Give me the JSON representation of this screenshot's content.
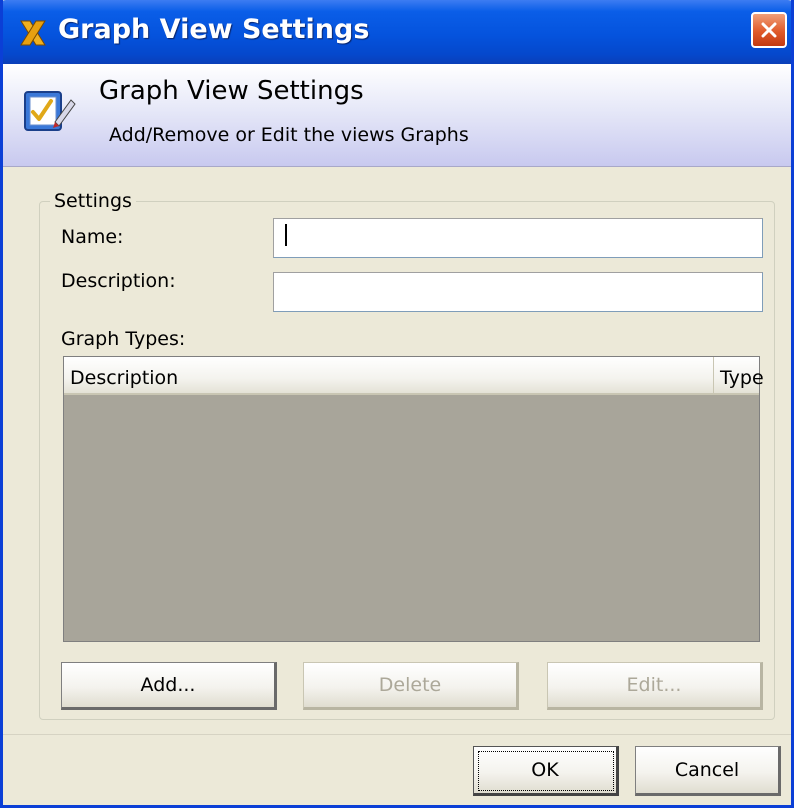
{
  "window": {
    "title": "Graph View Settings"
  },
  "header": {
    "title": "Graph View Settings",
    "subtitle": "Add/Remove or Edit the views Graphs"
  },
  "settings": {
    "legend": "Settings",
    "name_label": "Name:",
    "name_value": "",
    "description_label": "Description:",
    "description_value": "",
    "graph_types_label": "Graph Types:",
    "table": {
      "columns": [
        "Description",
        "Type"
      ],
      "rows": []
    },
    "buttons": {
      "add": "Add...",
      "delete": "Delete",
      "edit": "Edit..."
    }
  },
  "dialog_buttons": {
    "ok": "OK",
    "cancel": "Cancel"
  },
  "colors": {
    "titlebar": "#0553dd",
    "close": "#e05a2a",
    "list_background": "#a8a59a",
    "window_background": "#ece9d8"
  },
  "icons": {
    "app": "app-x-icon",
    "close": "close-icon",
    "header": "settings-checklist-icon"
  }
}
